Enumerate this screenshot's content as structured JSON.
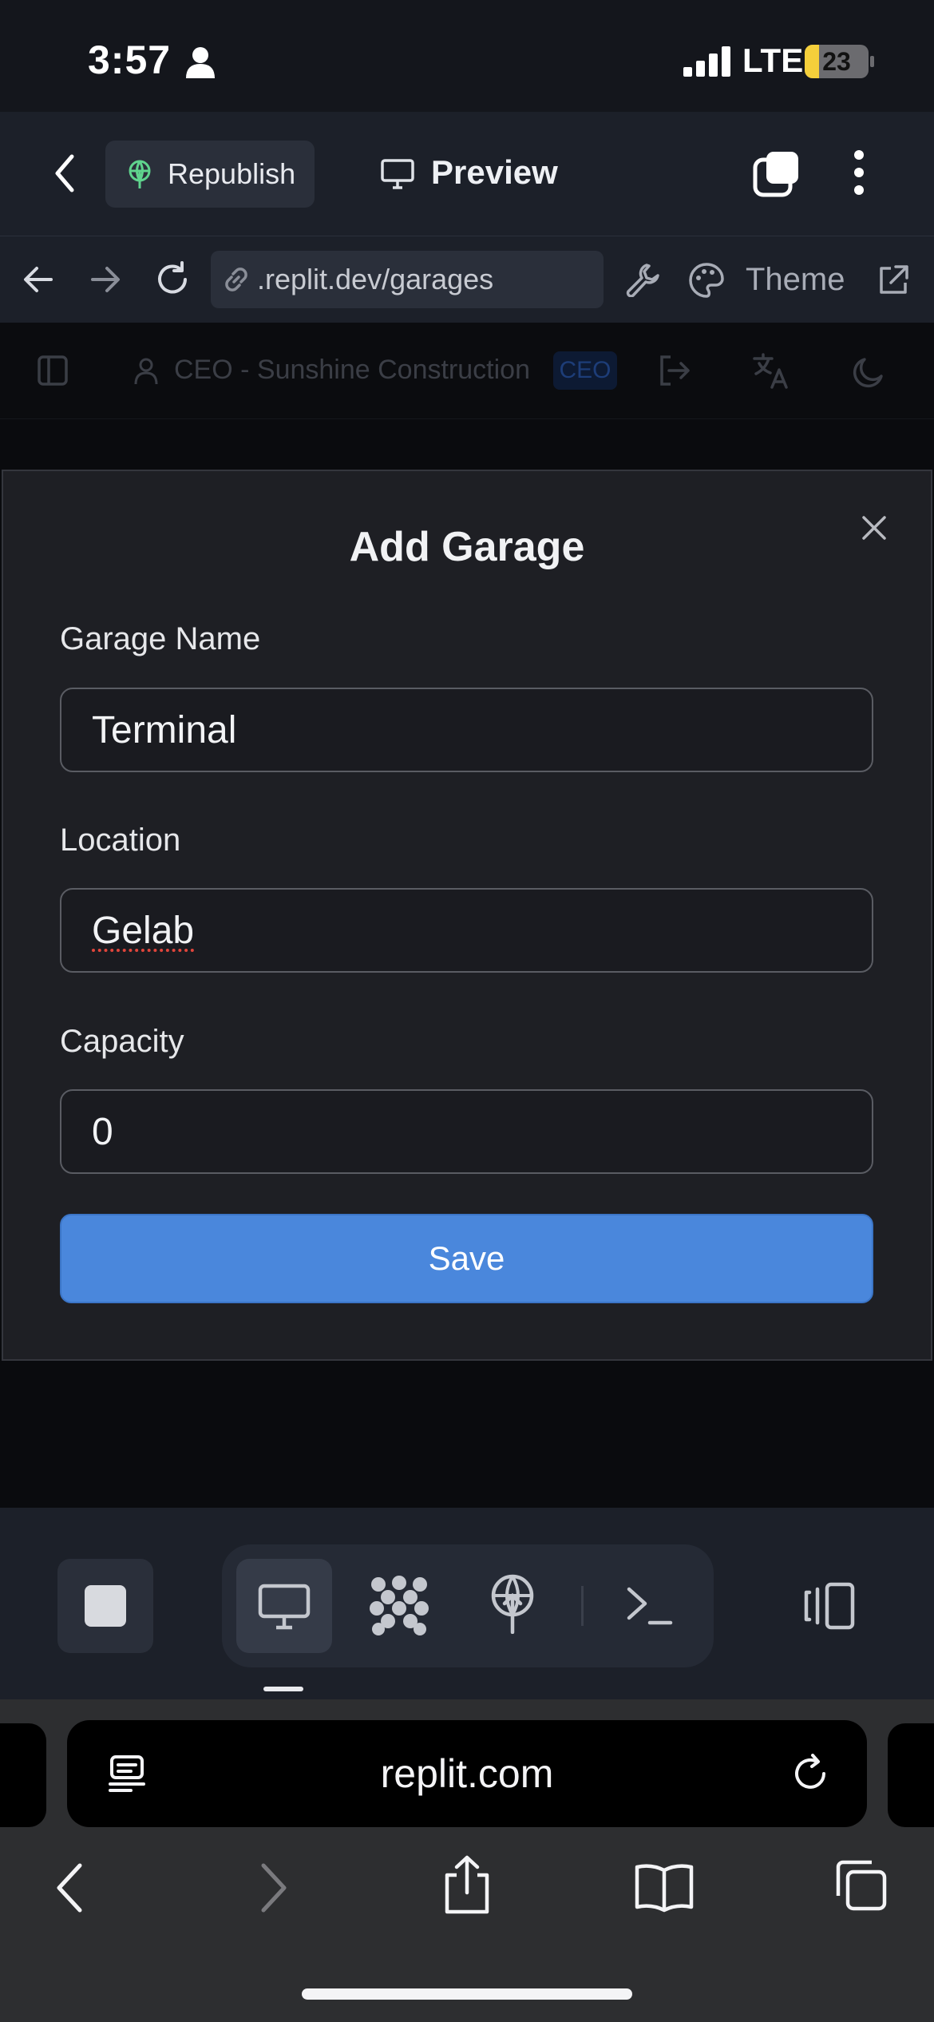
{
  "status_bar": {
    "time": "3:57",
    "network": "LTE",
    "battery": "23",
    "battery_level_percent": 23,
    "icons": [
      "person-icon",
      "signal-icon",
      "battery-charging-icon"
    ]
  },
  "replit_header": {
    "republish_label": "Republish",
    "preview_label": "Preview",
    "icons": [
      "back-chevron-icon",
      "republish-icon",
      "monitor-icon",
      "tabs-icon",
      "more-vertical-icon"
    ]
  },
  "browser_bar": {
    "url": ".replit.dev/garages",
    "theme_label": "Theme",
    "icons": [
      "back-arrow-icon",
      "forward-arrow-icon",
      "reload-icon",
      "link-icon",
      "wrench-icon",
      "palette-icon",
      "external-link-icon"
    ]
  },
  "app_header": {
    "user_label": "CEO - Sunshine Construction",
    "role_badge": "CEO",
    "icons": [
      "sidebar-toggle-icon",
      "user-icon",
      "logout-icon",
      "translate-icon",
      "moon-icon"
    ]
  },
  "modal": {
    "title": "Add Garage",
    "fields": [
      {
        "label": "Garage Name",
        "value": "Terminal"
      },
      {
        "label": "Location",
        "value": "Gelab"
      },
      {
        "label": "Capacity",
        "value": "0"
      }
    ],
    "save_label": "Save",
    "icons": [
      "close-icon"
    ]
  },
  "bottom_toolbar": {
    "icons": [
      "stop-icon",
      "monitor-icon",
      "agent-icon",
      "deploy-icon",
      "terminal-icon",
      "device-switch-icon"
    ]
  },
  "safari": {
    "domain": "replit.com",
    "icons": [
      "reader-icon",
      "reload-icon",
      "back-icon",
      "forward-icon",
      "share-icon",
      "bookmarks-icon",
      "tabs-icon"
    ]
  },
  "colors": {
    "accent": "#4a87dc",
    "modal_bg": "#1e1f24",
    "header_bg": "#1c2029",
    "republish_icon": "#5fd38d",
    "spellcheck": "#e0453b"
  }
}
